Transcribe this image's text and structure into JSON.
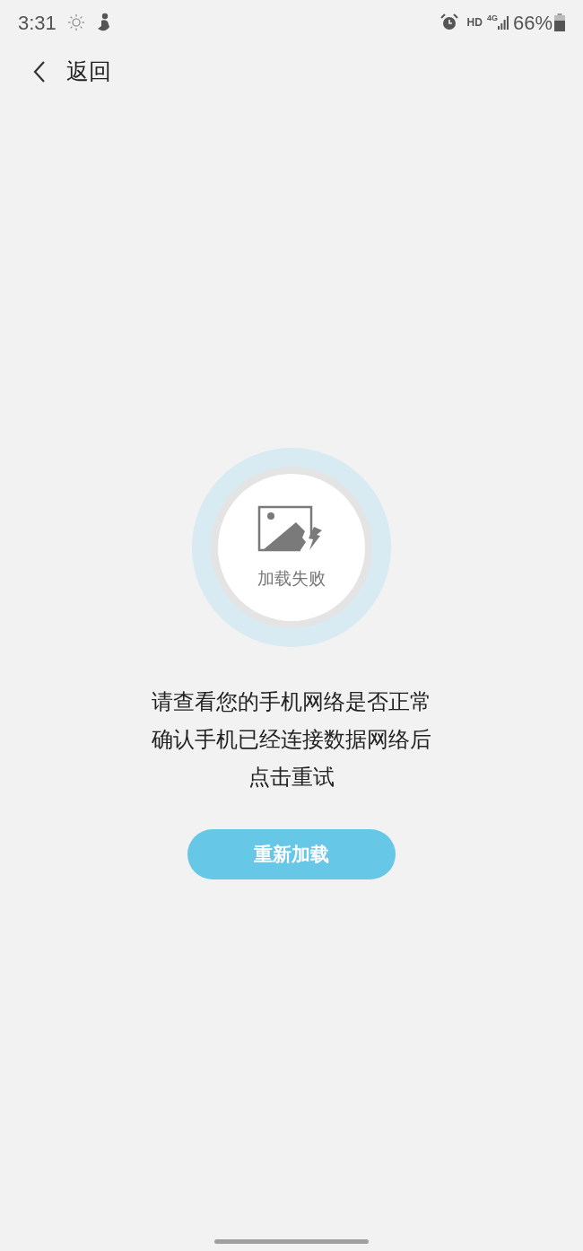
{
  "status_bar": {
    "time": "3:31",
    "network_label": "HD",
    "network_type": "4G",
    "battery": "66%"
  },
  "nav": {
    "back_label": "返回"
  },
  "error": {
    "badge_text": "加载失败",
    "message_lines": [
      "请查看您的手机网络是否正常",
      "确认手机已经连接数据网络后",
      "点击重试"
    ],
    "button": "重新加载"
  }
}
